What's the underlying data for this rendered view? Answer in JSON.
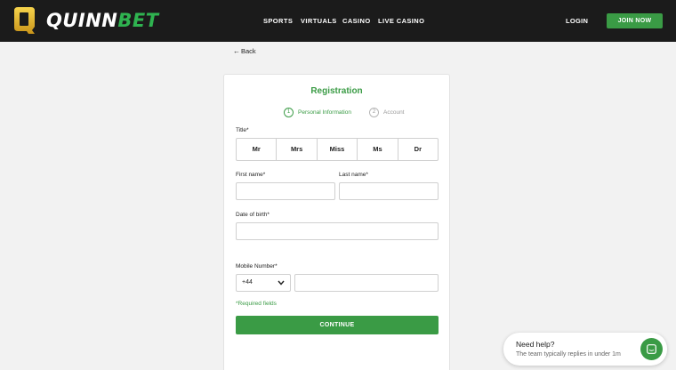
{
  "header": {
    "logo_mark": "Q",
    "logo_quinn": "QUINN",
    "logo_bet": "BET",
    "nav": [
      "SPORTS",
      "VIRTUALS",
      "CASINO",
      "LIVE CASINO"
    ],
    "login": "LOGIN",
    "join": "JOIN NOW"
  },
  "back_label": "Back",
  "registration": {
    "title": "Registration",
    "steps": [
      {
        "num": "1",
        "label": "Personal Information",
        "active": true
      },
      {
        "num": "2",
        "label": "Account",
        "active": false
      }
    ],
    "title_label": "Title*",
    "title_options": [
      "Mr",
      "Mrs",
      "Miss",
      "Ms",
      "Dr"
    ],
    "first_name_label": "First name*",
    "last_name_label": "Last name*",
    "dob_label": "Date of birth*",
    "mobile_label": "Mobile Number*",
    "country_code": "+44",
    "required_note": "*Required fields",
    "continue": "CONTINUE"
  },
  "help": {
    "title": "Need help?",
    "subtitle": "The team typically replies in under 1m"
  },
  "colors": {
    "brand_green": "#3a9b45",
    "logo_gold": "#e2b321",
    "header_bg": "#1b1b1b"
  },
  "icons": [
    "logo-q-icon",
    "back-arrow-icon",
    "chevron-down-icon",
    "chat-icon"
  ]
}
